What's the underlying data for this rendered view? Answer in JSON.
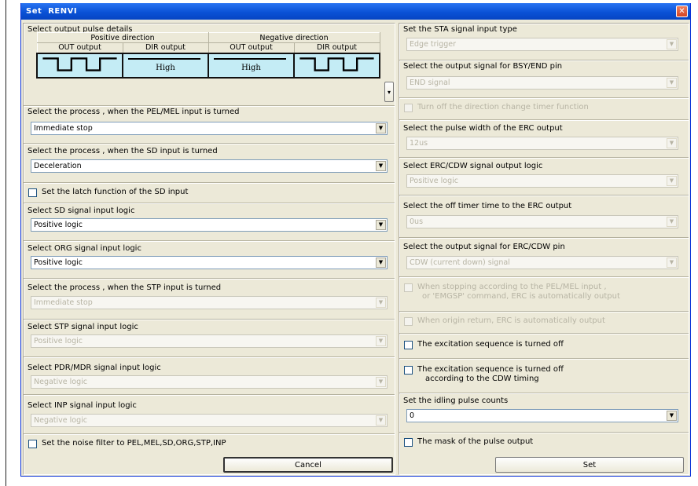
{
  "window": {
    "title": "Set  RENVI",
    "close": "✕"
  },
  "left": {
    "pulse": {
      "label": "Select output pulse details",
      "pos_dir": "Positive direction",
      "neg_dir": "Negative direction",
      "out1": "OUT output",
      "dir1": "DIR output",
      "out2": "OUT output",
      "dir2": "DIR output",
      "high1": "High",
      "high2": "High"
    },
    "pelmel": {
      "label": "Select the process , when the PEL/MEL input is turned",
      "value": "Immediate stop"
    },
    "sd": {
      "label": "Select the process , when the SD input is turned",
      "value": "Deceleration"
    },
    "latch": {
      "label": "Set the latch function of the SD input"
    },
    "sdlogic": {
      "label": "Select SD signal input logic",
      "value": "Positive logic"
    },
    "orglogic": {
      "label": "Select ORG signal input logic",
      "value": "Positive logic"
    },
    "stp": {
      "label": "Select the process , when the STP input is turned",
      "value": "Immediate stop"
    },
    "stplogic": {
      "label": "Select STP signal input logic",
      "value": "Positive logic"
    },
    "pdrlogic": {
      "label": "Select PDR/MDR signal input logic",
      "value": "Negative logic"
    },
    "inplogic": {
      "label": "Select INP signal input logic",
      "value": "Negative logic"
    },
    "noise": {
      "label": "Set the noise filter to PEL,MEL,SD,ORG,STP,INP"
    },
    "cancel": "Cancel"
  },
  "right": {
    "sta": {
      "label": "Set the STA signal input type",
      "value": "Edge trigger"
    },
    "bsy": {
      "label": "Select the output signal for BSY/END pin",
      "value": "END signal"
    },
    "dirtimer": {
      "label": "Turn off the direction change timer function"
    },
    "erc_width": {
      "label": "Select the pulse width of the ERC output",
      "value": "12us"
    },
    "erc_logic": {
      "label": "Select ERC/CDW signal output logic",
      "value": "Positive logic"
    },
    "erc_off": {
      "label": "Select the off timer time to the ERC output",
      "value": "0us"
    },
    "erc_pin": {
      "label": "Select the output signal for ERC/CDW pin",
      "value": "CDW (current down) signal"
    },
    "auto1": {
      "line1": "When stopping according to the PEL/MEL input ,",
      "line2": "or 'EMGSP' command, ERC is automatically output"
    },
    "auto2": {
      "label": "When origin return, ERC is automatically output"
    },
    "exc1": {
      "label": "The excitation sequence is turned off"
    },
    "exc2": {
      "line1": "The excitation sequence is turned off",
      "line2": "according to the CDW timing"
    },
    "idling": {
      "label": "Set the idling  pulse counts",
      "value": "0"
    },
    "mask": {
      "label": "The mask of the pulse output"
    },
    "set": "Set"
  }
}
